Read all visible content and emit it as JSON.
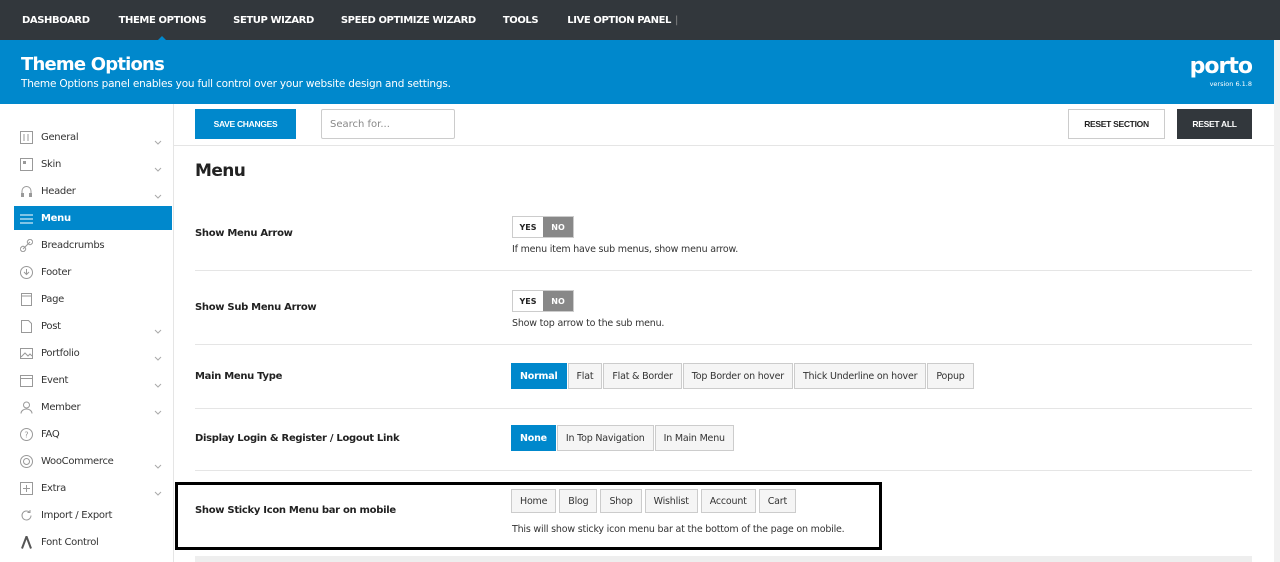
{
  "topnav": {
    "items": [
      "DASHBOARD",
      "THEME OPTIONS",
      "SETUP WIZARD",
      "SPEED OPTIMIZE WIZARD",
      "TOOLS",
      "LIVE OPTION PANEL"
    ],
    "separator": "|"
  },
  "header": {
    "title": "Theme Options",
    "subtitle": "Theme Options panel enables you full control over your website design and settings.",
    "logo": "porto",
    "version": "version 6.1.8"
  },
  "toolbar": {
    "save_label": "SAVE CHANGES",
    "search_placeholder": "Search for...",
    "reset_section_label": "RESET SECTION",
    "reset_all_label": "RESET ALL"
  },
  "sidebar": {
    "items": [
      {
        "label": "General",
        "icon": "sliders-icon",
        "has_chevron": true
      },
      {
        "label": "Skin",
        "icon": "palette-icon",
        "has_chevron": true
      },
      {
        "label": "Header",
        "icon": "headphones-icon",
        "has_chevron": true
      },
      {
        "label": "Menu",
        "icon": "menu-icon",
        "has_chevron": false,
        "active": true
      },
      {
        "label": "Breadcrumbs",
        "icon": "link-icon",
        "has_chevron": false
      },
      {
        "label": "Footer",
        "icon": "arrow-down-circle-icon",
        "has_chevron": false
      },
      {
        "label": "Page",
        "icon": "page-icon",
        "has_chevron": false
      },
      {
        "label": "Post",
        "icon": "post-icon",
        "has_chevron": true
      },
      {
        "label": "Portfolio",
        "icon": "image-icon",
        "has_chevron": true
      },
      {
        "label": "Event",
        "icon": "calendar-icon",
        "has_chevron": true
      },
      {
        "label": "Member",
        "icon": "user-icon",
        "has_chevron": true
      },
      {
        "label": "FAQ",
        "icon": "question-icon",
        "has_chevron": false
      },
      {
        "label": "WooCommerce",
        "icon": "woo-icon",
        "has_chevron": true
      },
      {
        "label": "Extra",
        "icon": "extra-icon",
        "has_chevron": true
      },
      {
        "label": "Import / Export",
        "icon": "refresh-icon",
        "has_chevron": false
      },
      {
        "label": "Font Control",
        "icon": "font-icon",
        "has_chevron": false
      }
    ],
    "active_color": "#0088cc"
  },
  "main": {
    "section_title": "Menu",
    "fields": {
      "show_menu_arrow": {
        "label": "Show Menu Arrow",
        "yes": "YES",
        "no": "NO",
        "value": "NO",
        "desc": "If menu item have sub menus, show menu arrow."
      },
      "show_sub_menu_arrow": {
        "label": "Show Sub Menu Arrow",
        "yes": "YES",
        "no": "NO",
        "value": "NO",
        "desc": "Show top arrow to the sub menu."
      },
      "main_menu_type": {
        "label": "Main Menu Type",
        "options": [
          "Normal",
          "Flat",
          "Flat & Border",
          "Top Border on hover",
          "Thick Underline on hover",
          "Popup"
        ],
        "value": "Normal"
      },
      "login_link": {
        "label": "Display Login & Register / Logout Link",
        "options": [
          "None",
          "In Top Navigation",
          "In Main Menu"
        ],
        "value": "None"
      },
      "sticky_icon_menu": {
        "label": "Show Sticky Icon Menu bar on mobile",
        "options": [
          "Home",
          "Blog",
          "Shop",
          "Wishlist",
          "Account",
          "Cart"
        ],
        "desc": "This will show sticky icon menu bar at the bottom of the page on mobile."
      }
    }
  },
  "colors": {
    "brand": "#0088cc",
    "dark": "#32373c"
  }
}
